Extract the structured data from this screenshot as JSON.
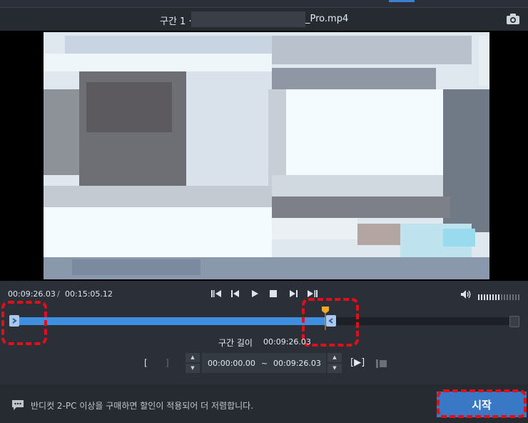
{
  "header": {
    "title_prefix": "구간 1 ·",
    "file_suffix": "_Pro.mp4"
  },
  "playback": {
    "current_time": "00:09:26.03",
    "separator": "/",
    "total_time": "00:15:05.12"
  },
  "timeline": {
    "playhead_fraction": 0.625
  },
  "segment": {
    "length_label": "구간 길이",
    "length_value": "00:09:26.03",
    "start_bracket": "[",
    "end_bracket": "]",
    "start_time": "00:00:00.00",
    "tilde": "~",
    "end_time": "00:09:26.03",
    "play_range_label": "[▶]"
  },
  "footer": {
    "notice": "반디컷 2-PC 이상을 구매하면 할인이 적용되어 더 저렴합니다.",
    "start_button": "시작"
  },
  "icons": [
    "camera-icon",
    "skip-back-icon",
    "frame-back-icon",
    "play-icon",
    "stop-icon",
    "frame-forward-icon",
    "skip-forward-icon",
    "volume-icon",
    "chat-icon"
  ],
  "colors": {
    "accent": "#3e8fe0",
    "start_button": "#3978c4",
    "playhead": "#f5a623",
    "highlight": "#e0101a"
  }
}
